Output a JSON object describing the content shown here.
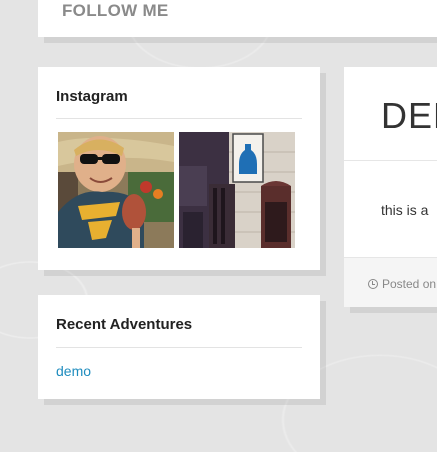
{
  "follow": {
    "title": "FOLLOW ME"
  },
  "instagram": {
    "title": "Instagram",
    "images": [
      {
        "icon": "selfie-photo"
      },
      {
        "icon": "storefront-photo"
      }
    ]
  },
  "recent": {
    "title": "Recent Adventures",
    "items": [
      {
        "label": "demo"
      }
    ]
  },
  "post": {
    "title": "DEMO",
    "excerpt": "this is a",
    "meta": "Posted on"
  },
  "colors": {
    "background": "#e4e4e4",
    "card": "#ffffff",
    "link": "#1e8cbe"
  }
}
